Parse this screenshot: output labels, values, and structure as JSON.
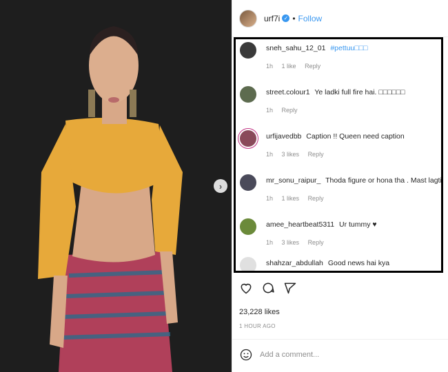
{
  "post": {
    "owner": "urf7i",
    "follow_label": "Follow",
    "separator": "•"
  },
  "comments": [
    {
      "user": "sneh_sahu_12_01",
      "body": "",
      "tag": "#pettuu□□□",
      "time": "1h",
      "likes": "1 like",
      "reply": "Reply",
      "avatar_color": "#3a3a3a"
    },
    {
      "user": "street.colour1",
      "body": "Ye ladki full fire hai. □□□□□□",
      "tag": "",
      "time": "1h",
      "likes": "",
      "reply": "Reply",
      "avatar_color": "#5d6b4f"
    },
    {
      "user": "urfijavedbb",
      "body": "Caption !! Queen need caption",
      "tag": "",
      "time": "1h",
      "likes": "3 likes",
      "reply": "Reply",
      "avatar_color": "#8a4a5a"
    },
    {
      "user": "mr_sonu_raipur_",
      "body": "Thoda figure or hona tha . Mast lagti □",
      "tag": "",
      "time": "1h",
      "likes": "1 likes",
      "reply": "Reply",
      "avatar_color": "#4a4a5a"
    },
    {
      "user": "amee_heartbeat5311",
      "body": "Ur tummy ♥",
      "tag": "",
      "time": "1h",
      "likes": "3 likes",
      "reply": "Reply",
      "avatar_color": "#6b8a3a"
    },
    {
      "user": "shahzar_abdullah",
      "body": "Good news hai kya",
      "tag": "",
      "time": "",
      "likes": "",
      "reply": "",
      "avatar_color": "#cfcfcf"
    }
  ],
  "stats": {
    "likes": "23,228 likes",
    "time_ago": "1 HOUR AGO"
  },
  "add_comment": {
    "placeholder": "Add a comment..."
  },
  "icons": [
    "heart-icon",
    "comment-icon",
    "share-icon",
    "emoji-icon",
    "verified-icon",
    "chevron-right-icon"
  ],
  "colors": {
    "accent": "#3897f0",
    "border_highlight": "#000000",
    "photo_bg": "#1c1c1c"
  }
}
